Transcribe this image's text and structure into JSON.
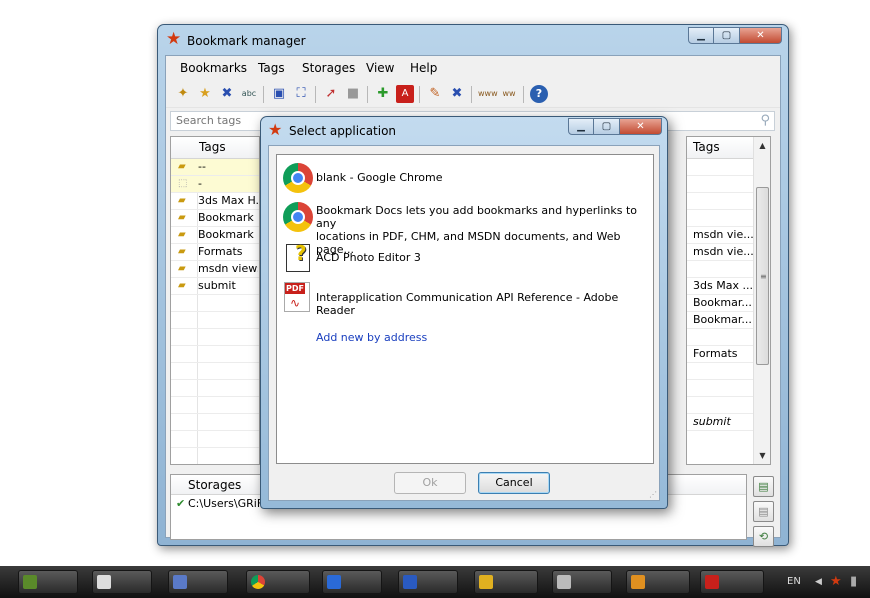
{
  "main_window": {
    "title": "Bookmark manager",
    "menu": [
      "Bookmarks",
      "Tags",
      "Storages",
      "View",
      "Help"
    ],
    "search_placeholder": "Search tags",
    "tags_header": "Tags",
    "tags": [
      "--",
      "-",
      "3ds Max H...",
      "Bookmark ...",
      "Bookmark ...",
      "Formats",
      "msdn views",
      "submit"
    ],
    "right_header": "Tags",
    "right_rows": [
      "",
      "",
      "",
      "",
      "msdn vie...",
      "msdn vie...",
      "",
      "3ds Max ...",
      "Bookmar...",
      "Bookmar...",
      "",
      "Formats",
      "",
      "",
      "",
      "submit"
    ],
    "storages_header": "Storages",
    "storages": [
      "C:\\Users\\GRiF\\"
    ]
  },
  "dialog": {
    "title": "Select application",
    "apps": [
      {
        "label": "blank - Google Chrome",
        "icon": "chrome-icon"
      },
      {
        "label_line1": "Bookmark Docs lets you add bookmarks and hyperlinks to any",
        "label_line2": "locations in PDF, CHM, and MSDN documents, and Web page...",
        "icon": "chrome-icon"
      },
      {
        "label": "ACD Photo Editor 3",
        "icon": "acd-photo-editor-icon"
      },
      {
        "label": "Interapplication Communication API Reference - Adobe Reader",
        "icon": "pdf-icon"
      }
    ],
    "add_new_link": "Add new by address",
    "ok_label": "Ok",
    "cancel_label": "Cancel"
  },
  "taskbar": {
    "tray_lang": "EN"
  },
  "colors": {
    "accent_star": "#d23a10",
    "link": "#1a3fbf"
  }
}
